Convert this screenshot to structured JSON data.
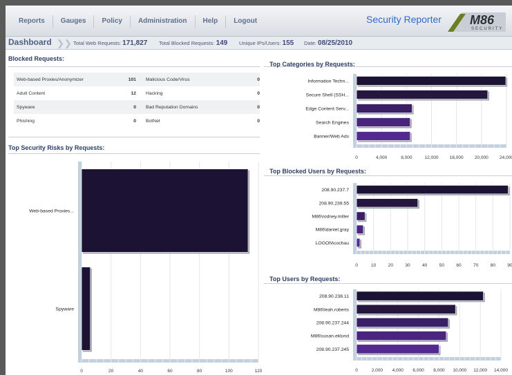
{
  "nav": {
    "items": [
      "Reports",
      "Gauges",
      "Policy",
      "Administration",
      "Help",
      "Logout"
    ],
    "app_title": "Security Reporter",
    "logo_text": "M86",
    "logo_sub": "SECURITY"
  },
  "dashboard": {
    "title": "Dashboard",
    "total_web_requests_label": "Total Web Requests:",
    "total_web_requests": "171,827",
    "total_blocked_label": "Total Blocked Requests:",
    "total_blocked": "149",
    "unique_label": "Unique IPs/Users:",
    "unique": "155",
    "date_label": "Date:",
    "date": "08/25/2010"
  },
  "blocked_requests": {
    "title": "Blocked Requests:",
    "rows": [
      {
        "left_label": "Web-based Proxies/Anonymizer",
        "left_value": "101",
        "right_label": "Malicious Code/Virus",
        "right_value": "0"
      },
      {
        "left_label": "Adult Content",
        "left_value": "12",
        "right_label": "Hacking",
        "right_value": "0"
      },
      {
        "left_label": "Spyware",
        "left_value": "0",
        "right_label": "Bad Reputation Domains",
        "right_value": "0"
      },
      {
        "left_label": "Phishing",
        "left_value": "0",
        "right_label": "BotNet",
        "right_value": "0"
      }
    ]
  },
  "chart_data": [
    {
      "type": "bar",
      "title": "Top Security Risks by Requests:",
      "orientation": "horizontal",
      "categories": [
        "Web-based Proxies...",
        "Spyware"
      ],
      "values": [
        113,
        6
      ],
      "xlim": [
        0,
        120
      ],
      "xticks": [
        "0",
        "20",
        "40",
        "60",
        "80",
        "100",
        "120"
      ],
      "grid": true,
      "color": "#1c1233"
    },
    {
      "type": "bar",
      "title": "Top Categories by Requests:",
      "orientation": "horizontal",
      "categories": [
        "Information Techn...",
        "Secure Shell (SSH...",
        "Edge Content Serv...",
        "Search Engines",
        "Banner/Web Ads"
      ],
      "values": [
        23900,
        21000,
        8900,
        8600,
        8600
      ],
      "xlim": [
        0,
        24000
      ],
      "xticks": [
        "0",
        "4,000",
        "8,000",
        "12,000",
        "16,000",
        "20,000",
        "24,000"
      ],
      "grid": true,
      "colors": [
        "#1c1233",
        "#24163f",
        "#3a1f66",
        "#4a2580",
        "#53298f"
      ]
    },
    {
      "type": "bar",
      "title": "Top Blocked Users by Requests:",
      "orientation": "horizontal",
      "categories": [
        "208.90.237.7",
        "208.90.239.55",
        "M86\\rodney.miller",
        "M86\\daniel.gray",
        "LOGON\\cochau"
      ],
      "values": [
        89,
        36,
        5,
        4,
        2
      ],
      "xlim": [
        0,
        90
      ],
      "xticks": [
        "0",
        "10",
        "20",
        "30",
        "40",
        "50",
        "60",
        "70",
        "80",
        "90"
      ],
      "grid": true,
      "colors": [
        "#1c1233",
        "#24163f",
        "#3a1f66",
        "#4a2580",
        "#53298f"
      ]
    },
    {
      "type": "bar",
      "title": "Top Users by Requests:",
      "orientation": "horizontal",
      "categories": [
        "208.90.238.11",
        "M86\\leah.roberts",
        "208.90.237.244",
        "M86\\susan.eklund",
        "208.90.237.245"
      ],
      "values": [
        12300,
        9600,
        8900,
        8700,
        8000
      ],
      "xlim": [
        0,
        14000
      ],
      "xticks": [
        "0",
        "2,000",
        "4,000",
        "6,000",
        "8,000",
        "10,000",
        "12,000",
        "14,000"
      ],
      "grid": true,
      "colors": [
        "#1c1233",
        "#24163f",
        "#3a1f66",
        "#4a2580",
        "#53298f"
      ]
    }
  ]
}
